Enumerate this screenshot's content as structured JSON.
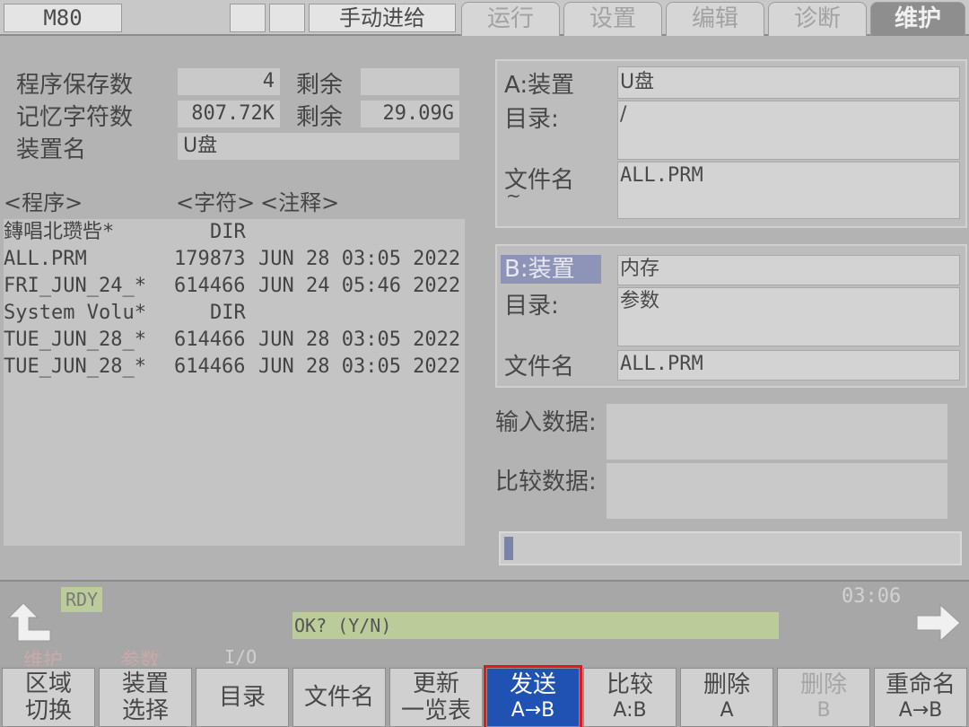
{
  "top": {
    "mode": "M80",
    "feed": "手动进给",
    "tabs": [
      "运行",
      "设置",
      "编辑",
      "诊断",
      "维护"
    ]
  },
  "left": {
    "prog_count_label": "程序保存数",
    "prog_count": "4",
    "remain_label_1": "剩余",
    "remain_1": "",
    "mem_label": "记忆字符数",
    "mem": "807.72K",
    "remain_label_2": "剩余",
    "remain_2": "29.09G",
    "device_label": "装置名",
    "device": "U盘",
    "col_program": "<程序>",
    "col_chars": "<字符>",
    "col_comment": "<注释>",
    "rows": [
      {
        "name": "鏄唱北瓒呰*",
        "size": "DIR",
        "date": ""
      },
      {
        "name": "ALL.PRM",
        "size": "179873",
        "date": "JUN 28 03:05 2022"
      },
      {
        "name": "FRI_JUN_24_*",
        "size": "614466",
        "date": "JUN 24 05:46 2022"
      },
      {
        "name": "System Volu*",
        "size": "DIR",
        "date": ""
      },
      {
        "name": "TUE_JUN_28_*",
        "size": "614466",
        "date": "JUN 28 03:05 2022"
      },
      {
        "name": "TUE_JUN_28_*",
        "size": "614466",
        "date": "JUN 28 03:05 2022"
      }
    ]
  },
  "panel_a": {
    "device_label": "A:装置",
    "device": "U盘",
    "dir_label": "目录:",
    "dir": "/",
    "file_label": "文件名",
    "file_mark": "~",
    "file": "ALL.PRM"
  },
  "panel_b": {
    "device_label": "B:装置",
    "device": "内存",
    "dir_label": "目录:",
    "dir": "参数",
    "file_label": "文件名",
    "file": "ALL.PRM"
  },
  "data": {
    "input_label": "输入数据:",
    "compare_label": "比较数据:",
    "progress": 0.02
  },
  "status": {
    "rdy": "RDY",
    "time": "03:06",
    "prompt": "OK? (Y/N)",
    "crumb_1": "维护",
    "crumb_2": "参数",
    "crumb_3": "I/O"
  },
  "softkeys": [
    {
      "l1": "区域",
      "l2": "切换"
    },
    {
      "l1": "装置",
      "l2": "选择"
    },
    {
      "l1": "目录",
      "l2": ""
    },
    {
      "l1": "文件名",
      "l2": ""
    },
    {
      "l1": "更新",
      "l2": "一览表"
    },
    {
      "l1": "发送",
      "l2": "A→B"
    },
    {
      "l1": "比较",
      "l2": "A:B"
    },
    {
      "l1": "删除",
      "l2": "A"
    },
    {
      "l1": "删除",
      "l2": "B"
    },
    {
      "l1": "重命名",
      "l2": "A→B"
    }
  ],
  "colors": {
    "active_key": "#1f52b3",
    "highlight_border": "#e01919",
    "prompt_bg": "#bccb9a"
  }
}
